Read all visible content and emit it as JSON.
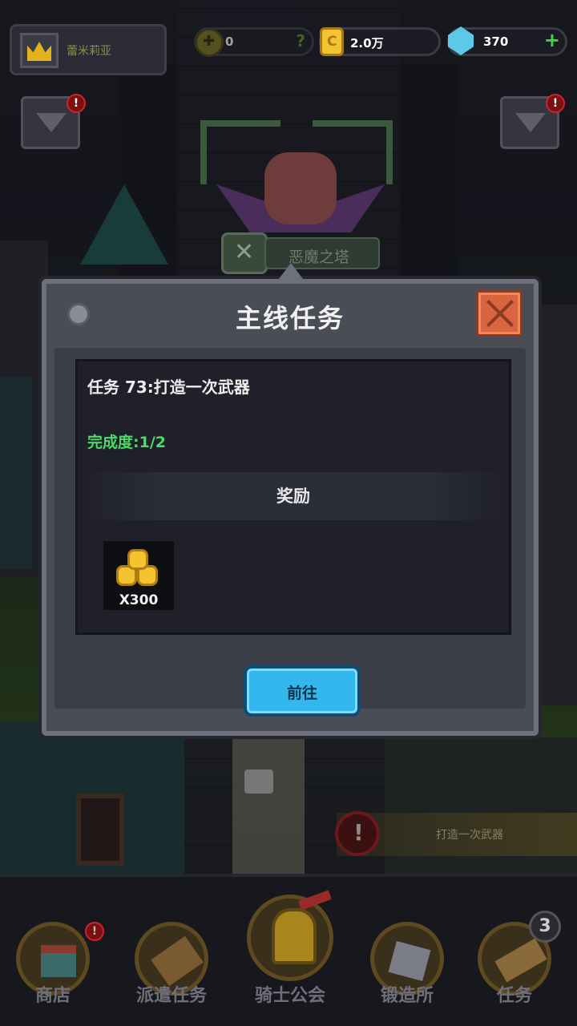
{
  "player": {
    "name": "蕾米莉亚"
  },
  "resources": {
    "honor": {
      "value": "0",
      "help": "?"
    },
    "gold": {
      "value": "2.0万"
    },
    "gems": {
      "value": "370",
      "add": "+"
    }
  },
  "alerts": {
    "left_badge": "!",
    "right_badge": "!"
  },
  "location": {
    "name": "恶魔之塔"
  },
  "modal": {
    "title": "主线任务",
    "task_text": "任务 73:打造一次武器",
    "progress_text": "完成度:1/2",
    "reward_header": "奖励",
    "reward": {
      "icon": "gold-coins-icon",
      "quantity": "X300"
    },
    "go_button": "前往"
  },
  "task_hint": {
    "text": "打造一次武器",
    "icon": "exclamation-icon"
  },
  "bottom_nav": [
    {
      "label": "商店",
      "icon": "shop-icon",
      "badge": "!"
    },
    {
      "label": "派遣任务",
      "icon": "dispatch-icon"
    },
    {
      "label": "骑士公会",
      "icon": "knight-icon"
    },
    {
      "label": "锻造所",
      "icon": "forge-hammer-icon"
    },
    {
      "label": "任务",
      "icon": "quest-scroll-icon",
      "count": "3"
    }
  ],
  "colors": {
    "progress_green": "#4cd964",
    "go_button": "#32b8ee",
    "close_button": "#d9643f",
    "gold": "#f4c430"
  }
}
